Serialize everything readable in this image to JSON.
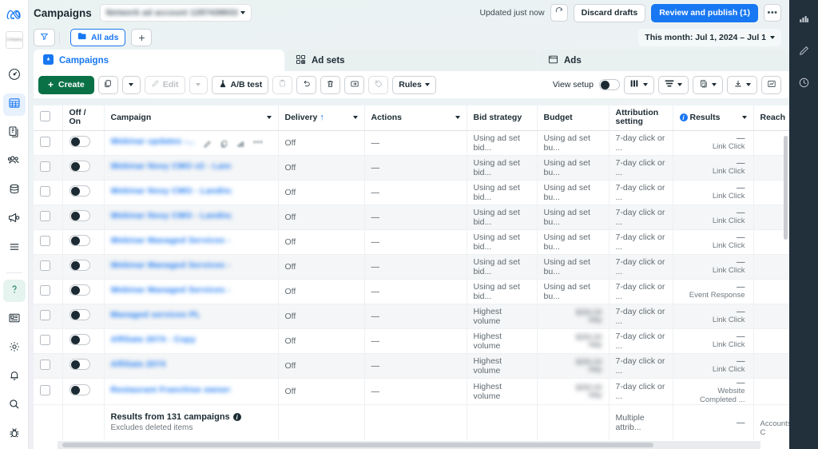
{
  "app": {
    "brand": "meta-logo",
    "page_title": "Campaigns",
    "account_selector_value": "",
    "updated_label": "Updated just now",
    "refresh_icon": "refresh-icon",
    "discard_label": "Discard drafts",
    "publish_label": "Review and publish (1)",
    "more_label": "•••"
  },
  "filters": {
    "filter_icon": "filter-icon",
    "all_ads_label": "All ads",
    "add_label": "+",
    "date_range": "This month: Jul 1, 2024 – Jul 1"
  },
  "tabs": [
    {
      "label": "Campaigns",
      "icon": "campaigns-icon",
      "active": true
    },
    {
      "label": "Ad sets",
      "icon": "adsets-icon",
      "active": false
    },
    {
      "label": "Ads",
      "icon": "ads-icon",
      "active": false
    }
  ],
  "toolbar": {
    "create_label": "Create",
    "duplicate_icon": "duplicate-icon",
    "edit_label": "Edit",
    "edit_icon": "pencil-icon",
    "abtest_label": "A/B test",
    "abtest_icon": "flask-icon",
    "paste_icon": "clipboard-icon",
    "undo_icon": "undo-icon",
    "delete_icon": "trash-icon",
    "export_sheet_icon": "export-icon",
    "tag_icon": "tag-icon",
    "rules_label": "Rules",
    "view_setup_label": "View setup",
    "columns_icon": "columns-icon",
    "breakdown_icon": "breakdown-icon",
    "reports_icon": "reports-icon",
    "download_icon": "download-icon",
    "chart_icon": "chart-icon"
  },
  "table": {
    "columns": [
      {
        "key": "select",
        "label": ""
      },
      {
        "key": "onoff",
        "label": "Off /\nOn"
      },
      {
        "key": "campaign",
        "label": "Campaign",
        "menu": true
      },
      {
        "key": "delivery",
        "label": "Delivery",
        "menu": true,
        "sort": "↑"
      },
      {
        "key": "actions",
        "label": "Actions",
        "menu": true
      },
      {
        "key": "bid",
        "label": "Bid strategy"
      },
      {
        "key": "budget",
        "label": "Budget"
      },
      {
        "key": "attrib",
        "label": "Attribution setting"
      },
      {
        "key": "results",
        "label": "Results",
        "menu": true,
        "info": true
      },
      {
        "key": "reach",
        "label": "Reach"
      }
    ],
    "rows": [
      {
        "delivery": "Off",
        "actions": "—",
        "bid": "Using ad set bid...",
        "budget": "Using ad set bu...",
        "attrib": "7-day click or ...",
        "results": "—",
        "results_sub": "Link Click",
        "reach": "",
        "row_actions": true
      },
      {
        "delivery": "Off",
        "actions": "—",
        "bid": "Using ad set bid...",
        "budget": "Using ad set bu...",
        "attrib": "7-day click or ...",
        "results": "—",
        "results_sub": "Link Click",
        "reach": ""
      },
      {
        "delivery": "Off",
        "actions": "—",
        "bid": "Using ad set bid...",
        "budget": "Using ad set bu...",
        "attrib": "7-day click or ...",
        "results": "—",
        "results_sub": "Link Click",
        "reach": ""
      },
      {
        "delivery": "Off",
        "actions": "—",
        "bid": "Using ad set bid...",
        "budget": "Using ad set bu...",
        "attrib": "7-day click or ...",
        "results": "—",
        "results_sub": "Link Click",
        "reach": ""
      },
      {
        "delivery": "Off",
        "actions": "—",
        "bid": "Using ad set bid...",
        "budget": "Using ad set bu...",
        "attrib": "7-day click or ...",
        "results": "—",
        "results_sub": "Link Click",
        "reach": ""
      },
      {
        "delivery": "Off",
        "actions": "—",
        "bid": "Using ad set bid...",
        "budget": "Using ad set bu...",
        "attrib": "7-day click or ...",
        "results": "—",
        "results_sub": "Link Click",
        "reach": ""
      },
      {
        "delivery": "Off",
        "actions": "—",
        "bid": "Using ad set bid...",
        "budget": "Using ad set bu...",
        "attrib": "7-day click or ...",
        "results": "—",
        "results_sub": "Event Response",
        "reach": ""
      },
      {
        "delivery": "Off",
        "actions": "—",
        "bid": "Highest volume",
        "budget": "blurred",
        "attrib": "7-day click or ...",
        "results": "—",
        "results_sub": "Link Click",
        "reach": ""
      },
      {
        "delivery": "Off",
        "actions": "—",
        "bid": "Highest volume",
        "budget": "blurred",
        "attrib": "7-day click or ...",
        "results": "—",
        "results_sub": "Link Click",
        "reach": ""
      },
      {
        "delivery": "Off",
        "actions": "—",
        "bid": "Highest volume",
        "budget": "blurred",
        "attrib": "7-day click or ...",
        "results": "—",
        "results_sub": "Link Click",
        "reach": ""
      },
      {
        "delivery": "Off",
        "actions": "—",
        "bid": "Highest volume",
        "budget": "blurred",
        "attrib": "7-day click or ...",
        "results": "—",
        "results_sub": "Website Completed ...",
        "reach": ""
      }
    ],
    "footer": {
      "summary": "Results from 131 campaigns",
      "sub": "Excludes deleted items",
      "attrib": "Multiple attrib...",
      "results": "—",
      "reach": "Accounts C"
    }
  },
  "left_rail": {
    "items": [
      {
        "icon": "gauge-icon",
        "name": "overview",
        "active": false
      },
      {
        "icon": "table-icon",
        "name": "campaigns",
        "active": true
      },
      {
        "icon": "pages-icon",
        "name": "creatives",
        "active": false
      },
      {
        "icon": "audiences-icon",
        "name": "audiences",
        "active": false
      },
      {
        "icon": "billing-icon",
        "name": "billing",
        "active": false
      },
      {
        "icon": "megaphone-icon",
        "name": "ads-reporting",
        "active": false
      },
      {
        "icon": "menu-icon",
        "name": "all-tools",
        "active": false
      }
    ],
    "bottom": [
      {
        "icon": "help-icon",
        "name": "help",
        "highlight": true
      },
      {
        "icon": "news-icon",
        "name": "news"
      },
      {
        "icon": "gear-icon",
        "name": "settings"
      },
      {
        "icon": "bell-icon",
        "name": "notifications"
      },
      {
        "icon": "search-icon",
        "name": "search"
      },
      {
        "icon": "bug-icon",
        "name": "report-bug"
      }
    ]
  },
  "right_rail": {
    "items": [
      {
        "icon": "bar-chart-icon",
        "name": "insights"
      },
      {
        "icon": "pencil-icon",
        "name": "edit-panel"
      },
      {
        "icon": "clock-icon",
        "name": "activity-history"
      }
    ]
  }
}
